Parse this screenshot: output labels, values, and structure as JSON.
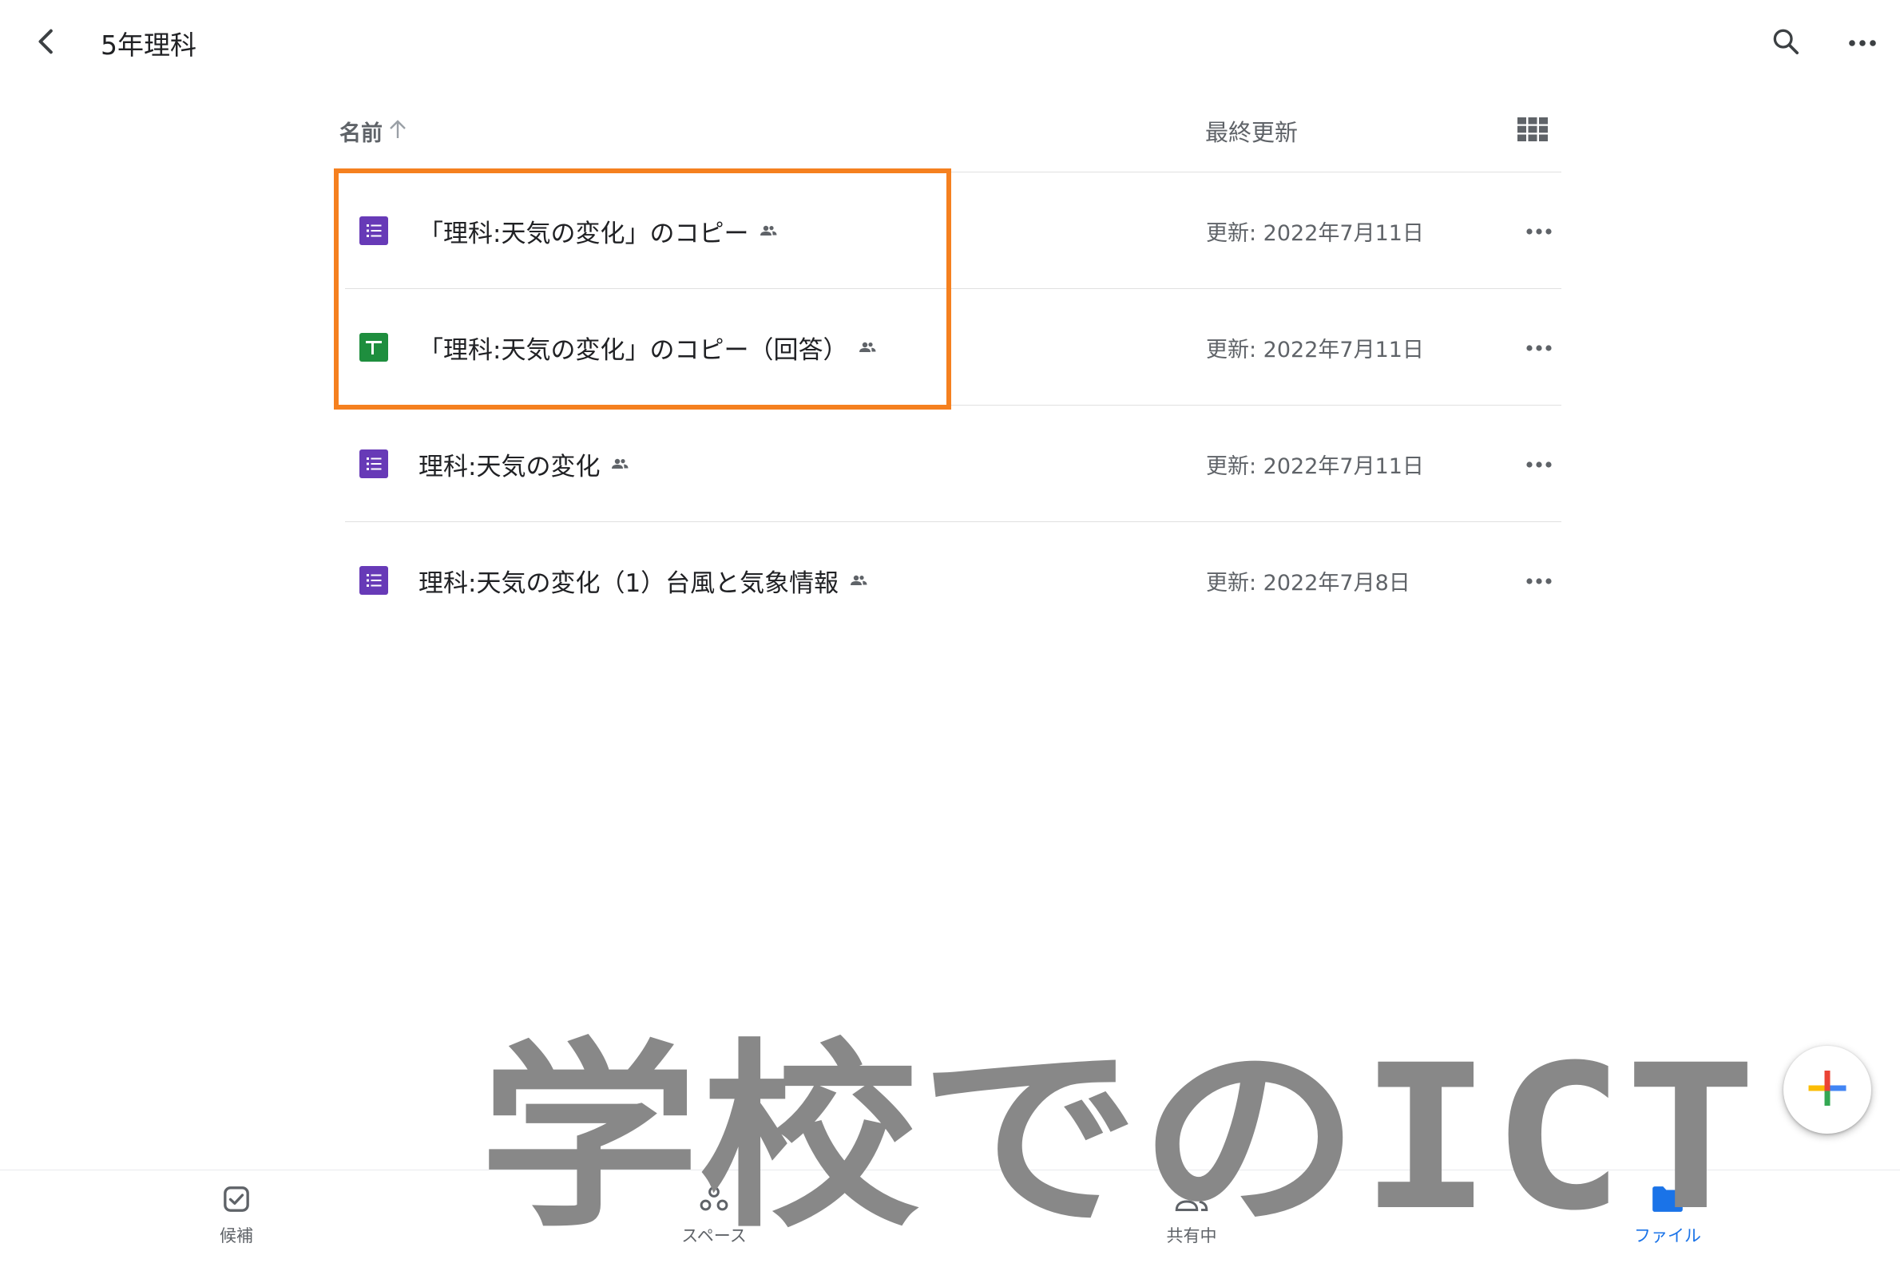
{
  "topbar": {
    "title": "5年理科",
    "back_icon": "chevron-left-icon",
    "search_icon": "search-icon",
    "more_icon": "more-horiz-icon"
  },
  "columns": {
    "name_label": "名前",
    "name_sort_icon": "arrow-up-icon",
    "last_modified_label": "最終更新",
    "view_toggle_icon": "grid-view-icon"
  },
  "files": [
    {
      "name": "「理科:天気の変化」のコピー",
      "type": "forms",
      "shared": true,
      "modified": "更新: 2022年7月11日"
    },
    {
      "name": "「理科:天気の変化」のコピー（回答）",
      "type": "sheets",
      "shared": true,
      "modified": "更新: 2022年7月11日"
    },
    {
      "name": "理科:天気の変化",
      "type": "forms",
      "shared": true,
      "modified": "更新: 2022年7月11日"
    },
    {
      "name": "理科:天気の変化（1）台風と気象情報",
      "type": "forms",
      "shared": true,
      "modified": "更新: 2022年7月8日"
    }
  ],
  "colors": {
    "forms": "#673ab7",
    "sheets": "#1e8e3e",
    "highlight": "#f5801f",
    "accent": "#1a73e8",
    "watermark": "#888888"
  },
  "watermark": {
    "text": "学校でのICT"
  },
  "fab": {
    "icon": "plus-icon"
  },
  "bottom_nav": [
    {
      "label": "候補",
      "icon": "suggested-icon",
      "active": false
    },
    {
      "label": "スペース",
      "icon": "spaces-icon",
      "active": false
    },
    {
      "label": "共有中",
      "icon": "people-icon",
      "active": false
    },
    {
      "label": "ファイル",
      "icon": "folder-icon",
      "active": true
    }
  ]
}
